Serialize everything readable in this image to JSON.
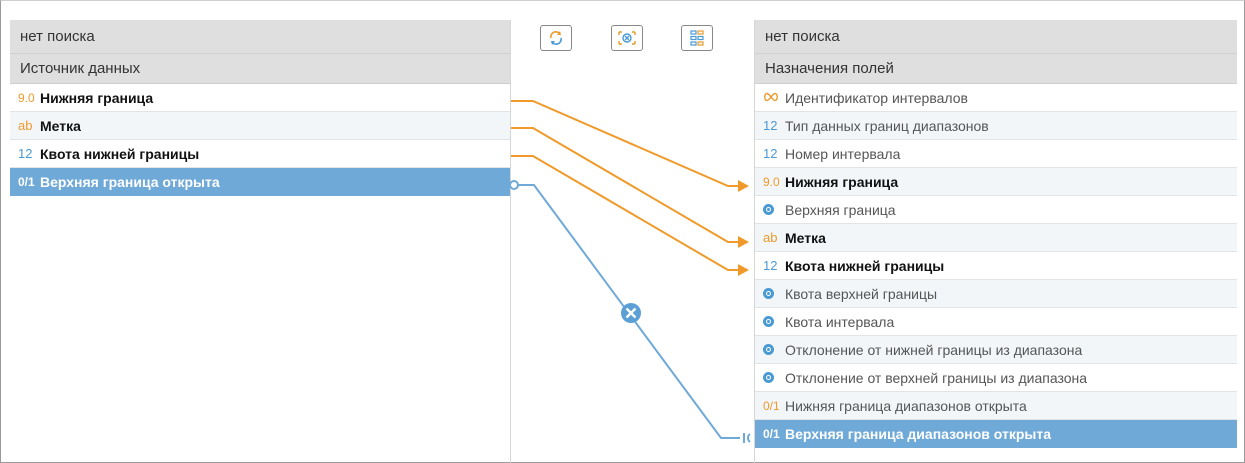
{
  "left_panel": {
    "search": "нет поиска",
    "header": "Источник данных",
    "rows": [
      {
        "type": "9.0",
        "label": "Нижняя граница"
      },
      {
        "type": "ab",
        "label": "Метка"
      },
      {
        "type": "12",
        "label": "Квота нижней границы"
      },
      {
        "type": "0/1",
        "label": "Верхняя граница открыта"
      }
    ]
  },
  "right_panel": {
    "search": "нет поиска",
    "header": "Назначения полей",
    "rows": [
      {
        "type": "∞",
        "label": "Идентификатор интервалов"
      },
      {
        "type": "12",
        "label": "Тип данных границ диапазонов"
      },
      {
        "type": "12",
        "label": "Номер интервала"
      },
      {
        "type": "9.0",
        "label": "Нижняя граница"
      },
      {
        "type": "calc",
        "label": "Верхняя граница"
      },
      {
        "type": "ab",
        "label": "Метка"
      },
      {
        "type": "12",
        "label": "Квота нижней границы"
      },
      {
        "type": "calc",
        "label": "Квота верхней границы"
      },
      {
        "type": "calc",
        "label": "Квота интервала"
      },
      {
        "type": "calc",
        "label": "Отклонение от нижней границы из диапазона"
      },
      {
        "type": "calc",
        "label": "Отклонение от верхней границы из диапазона"
      },
      {
        "type": "0/1",
        "label": "Нижняя граница диапазонов открыта"
      },
      {
        "type": "0/1",
        "label": "Верхняя граница диапазонов открыта"
      }
    ]
  },
  "toolbar": {
    "buttons": [
      "auto-map-icon",
      "clear-mapping-icon",
      "layout-icon"
    ]
  },
  "colors": {
    "mapped_link": "#ef9a2a",
    "selected_link": "#6fa9d8",
    "selected_row": "#6fa9d8",
    "header_bg": "#dfdfdf"
  }
}
